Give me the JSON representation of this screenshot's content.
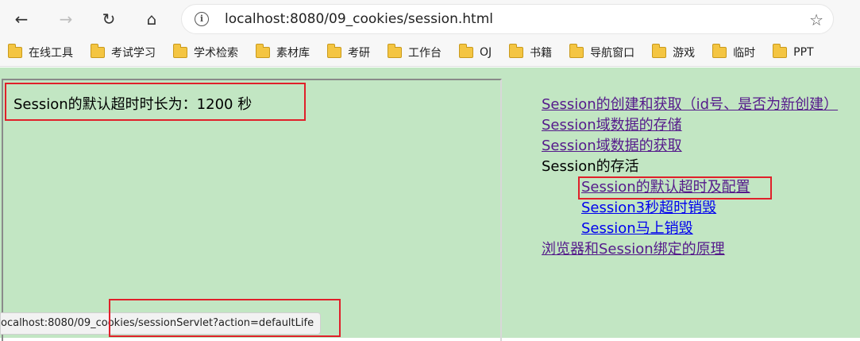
{
  "browser": {
    "url_host": "localhost",
    "url_path": ":8080/09_cookies/session.html",
    "back_icon": "←",
    "forward_icon": "→",
    "reload_icon": "↻",
    "home_icon": "⌂",
    "info_icon": "i",
    "star_icon": "☆"
  },
  "bookmarks": [
    {
      "label": "在线工具"
    },
    {
      "label": "考试学习"
    },
    {
      "label": "学术检索"
    },
    {
      "label": "素材库"
    },
    {
      "label": "考研"
    },
    {
      "label": "工作台"
    },
    {
      "label": "OJ"
    },
    {
      "label": "书籍"
    },
    {
      "label": "导航窗口"
    },
    {
      "label": "游戏"
    },
    {
      "label": "临时"
    },
    {
      "label": "PPT"
    }
  ],
  "left_frame": {
    "text": "Session的默认超时时长为：1200 秒"
  },
  "right_links": [
    {
      "label": "Session的创建和获取（id号、是否为新创建）",
      "style": "visited"
    },
    {
      "label": "Session域数据的存储",
      "style": "visited"
    },
    {
      "label": "Session域数据的获取",
      "style": "visited"
    },
    {
      "label": "Session的存活",
      "style": "plain"
    },
    {
      "label": "Session的默认超时及配置",
      "style": "visited"
    },
    {
      "label": "Session3秒超时销毁",
      "style": "unvisited"
    },
    {
      "label": "Session马上销毁",
      "style": "unvisited"
    },
    {
      "label": "浏览器和Session绑定的原理",
      "style": "visited"
    }
  ],
  "status": {
    "text": "ocalhost:8080/09_cookies/sessionServlet?action=defaultLife"
  },
  "colors": {
    "page_bg": "#c2e6c3",
    "highlight": "#e0202a",
    "visited_link": "#551a8b",
    "unvisited_link": "#0000ee"
  }
}
